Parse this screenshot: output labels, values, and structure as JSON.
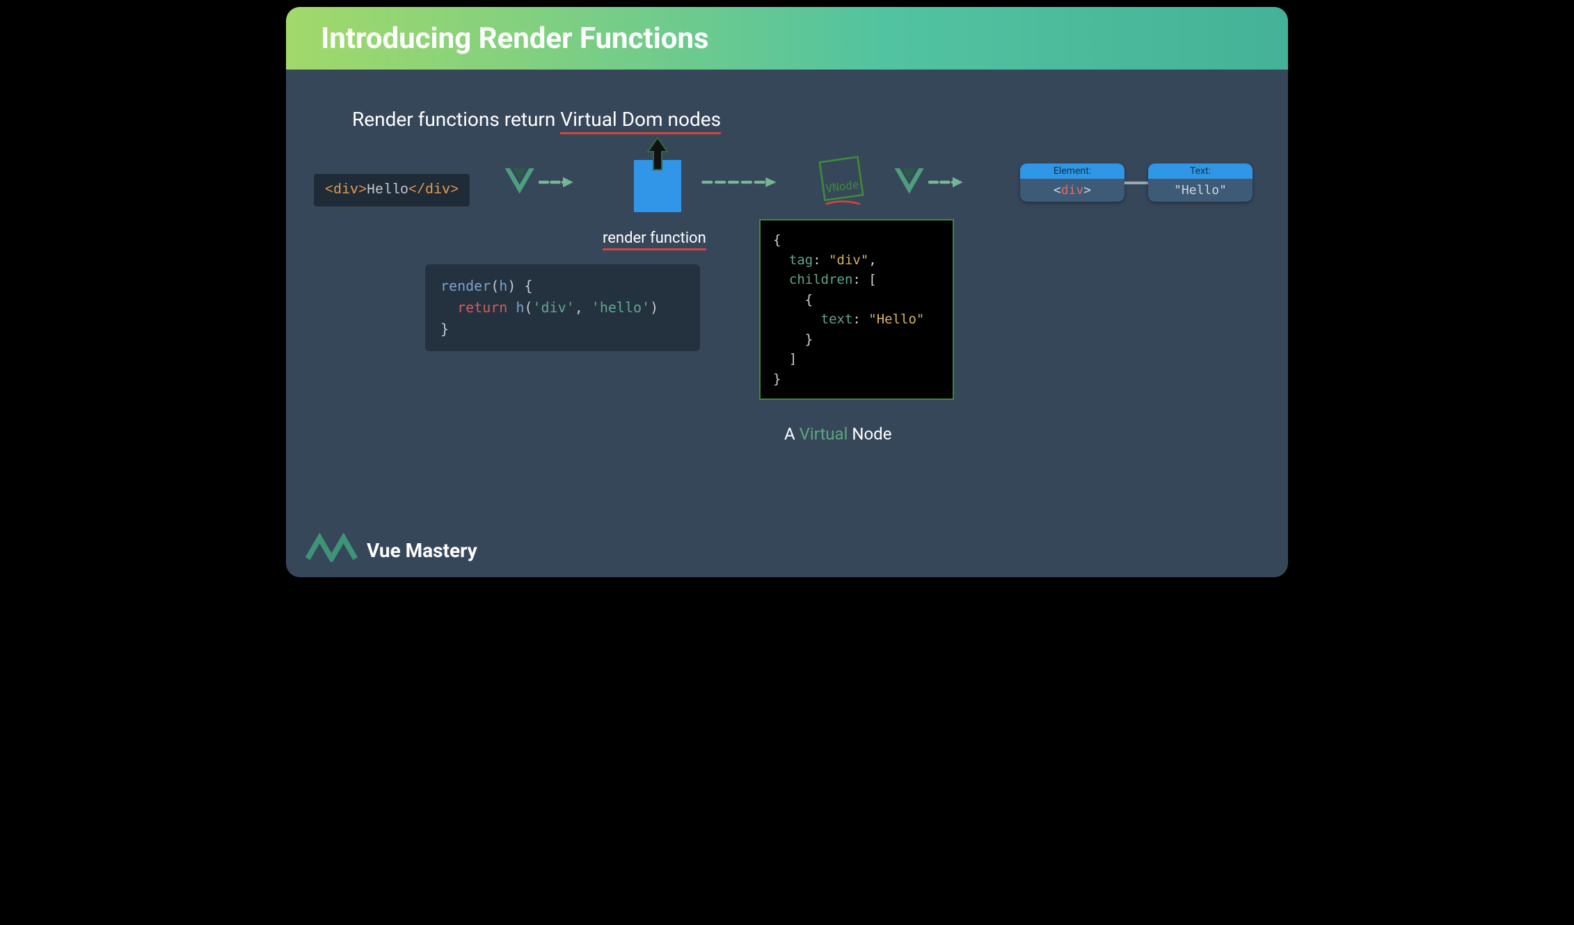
{
  "title": "Introducing Render Functions",
  "subtitle_prefix": "Render functions return ",
  "subtitle_emph": "Virtual Dom nodes",
  "hello_open": "<div>",
  "hello_text": "Hello",
  "hello_close": "</div>",
  "render_label": "render function",
  "vnode_tile_label": "VNode",
  "nodes": {
    "element": {
      "header": "Element:",
      "body_open": "<",
      "body_tag": "div",
      "body_close": ">"
    },
    "text": {
      "header": "Text:",
      "body": "\"Hello\""
    }
  },
  "render_code": {
    "l1a": "render",
    "l1b": "(",
    "l1c": "h",
    "l1d": ") {",
    "l2a": "  return ",
    "l2b": "h",
    "l2c": "(",
    "l2d": "'div'",
    "l2e": ", ",
    "l2f": "'hello'",
    "l2g": ")",
    "l3": "}"
  },
  "vnode_code": {
    "l1": "{",
    "l2a": "  tag",
    "l2b": ": ",
    "l2c": "\"div\"",
    "l2d": ",",
    "l3a": "  children",
    "l3b": ": [",
    "l4": "    {",
    "l5a": "      text",
    "l5b": ": ",
    "l5c": "\"Hello\"",
    "l6": "    }",
    "l7": "  ]",
    "l8": "}"
  },
  "vnode_caption_a": "A ",
  "vnode_caption_v": "Virtual",
  "vnode_caption_b": " Node",
  "brand": "Vue Mastery"
}
